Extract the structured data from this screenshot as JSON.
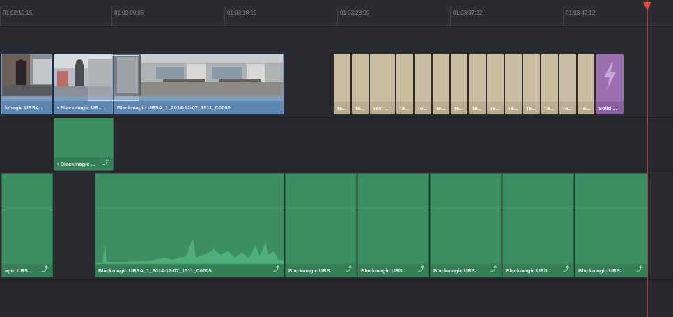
{
  "ruler": {
    "timecodes": [
      "01:02:59:15",
      "01:03:09:05",
      "01:03:18:19",
      "01:03:28:09",
      "01:03:37:22",
      "01:03:47:12"
    ]
  },
  "video_track": {
    "clips": [
      {
        "label": "kmagic URSA..."
      },
      {
        "label": "• Blackmagic UR..."
      },
      {
        "label": "Blackmagic URSA_1_2014-12-07_1511_C0005"
      }
    ],
    "title_clips": [
      "Te...",
      "Te...",
      "Text ...",
      "Te...",
      "Te...",
      "Te...",
      "Te...",
      "Te...",
      "Te...",
      "Te...",
      "Te...",
      "Te...",
      "Te...",
      "Te..."
    ],
    "solid_clip": {
      "label": "Solid ...",
      "icon": "lightning-icon"
    }
  },
  "audio_track_1": {
    "clips": [
      {
        "label": "• Blackmagic ..."
      }
    ]
  },
  "audio_track_2": {
    "clips": [
      {
        "label": "agic URS..."
      },
      {
        "label": "Blackmagic URSA_1_2014-12-07_1511_C0005"
      },
      {
        "label": "Blackmagic URS..."
      },
      {
        "label": "Blackmagic URS..."
      },
      {
        "label": "Blackmagic URS..."
      },
      {
        "label": "Blackmagic URS..."
      },
      {
        "label": "Blackmagic URS..."
      }
    ]
  },
  "colors": {
    "playhead": "#e24a3a",
    "video_clip": "#7c9cbe",
    "audio_clip": "#3c8f62",
    "title_clip": "#c9bfa0",
    "solid_clip": "#9b6fb0"
  }
}
